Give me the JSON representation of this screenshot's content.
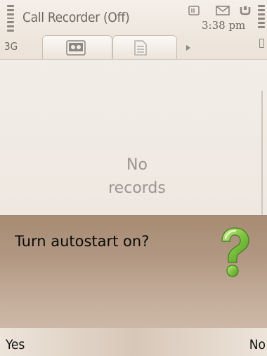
{
  "status_bar": {
    "app_title": "Call Recorder (Off)",
    "network": "3G",
    "time": "3:38 pm",
    "signal_icon": "signal-strength-icon",
    "battery_icon": "battery-level-icon",
    "indicators": [
      "document-icon",
      "mail-icon",
      "call-divert-icon"
    ]
  },
  "tabs": [
    {
      "icon": "recordings-icon",
      "selected": true
    },
    {
      "icon": "notes-document-icon",
      "selected": false
    }
  ],
  "content": {
    "empty_line1": "No",
    "empty_line2": "records"
  },
  "dialog": {
    "question": "Turn autostart on?",
    "icon": "question-mark-icon",
    "icon_color": "#7fc243"
  },
  "softkeys": {
    "left": "Yes",
    "right": "No"
  },
  "colors": {
    "dialog_bg": "#b19782",
    "status_text": "#6d6861",
    "empty_text": "#9a958f"
  }
}
